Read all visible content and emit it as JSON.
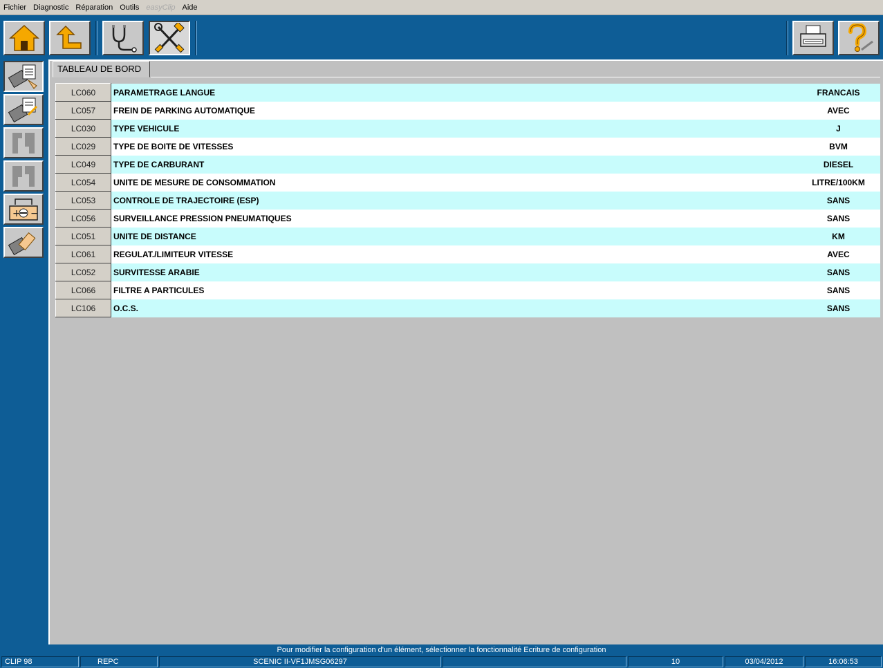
{
  "menu": {
    "items": [
      "Fichier",
      "Diagnostic",
      "Réparation",
      "Outils",
      "easyClip",
      "Aide"
    ]
  },
  "toolbar": {
    "buttons": [
      "home-icon",
      "back-arrow-icon",
      "stethoscope-icon",
      "tools-icon",
      "printer-icon",
      "help-icon"
    ]
  },
  "sidebar": {
    "buttons": [
      "ecu-config-read-icon",
      "ecu-config-write-icon",
      "parameters-icon",
      "parameters-alt-icon",
      "battery-icon",
      "ecu-erase-icon"
    ]
  },
  "main": {
    "tab_label": "TABLEAU DE BORD",
    "rows": [
      {
        "code": "LC060",
        "label": "PARAMETRAGE LANGUE",
        "value": "FRANCAIS"
      },
      {
        "code": "LC057",
        "label": "FREIN DE PARKING AUTOMATIQUE",
        "value": "AVEC"
      },
      {
        "code": "LC030",
        "label": "TYPE VEHICULE",
        "value": "J"
      },
      {
        "code": "LC029",
        "label": "TYPE DE BOITE DE VITESSES",
        "value": "BVM"
      },
      {
        "code": "LC049",
        "label": "TYPE DE CARBURANT",
        "value": "DIESEL"
      },
      {
        "code": "LC054",
        "label": "UNITE DE MESURE DE CONSOMMATION",
        "value": "LITRE/100KM"
      },
      {
        "code": "LC053",
        "label": "CONTROLE DE TRAJECTOIRE (ESP)",
        "value": "SANS"
      },
      {
        "code": "LC056",
        "label": "SURVEILLANCE PRESSION PNEUMATIQUES",
        "value": "SANS"
      },
      {
        "code": "LC051",
        "label": "UNITE DE DISTANCE",
        "value": "KM"
      },
      {
        "code": "LC061",
        "label": "REGULAT./LIMITEUR VITESSE",
        "value": "AVEC"
      },
      {
        "code": "LC052",
        "label": "SURVITESSE ARABIE",
        "value": "SANS"
      },
      {
        "code": "LC066",
        "label": "FILTRE A PARTICULES",
        "value": "SANS"
      },
      {
        "code": "LC106",
        "label": "O.C.S.",
        "value": "SANS"
      }
    ]
  },
  "status": {
    "message": "Pour modifier la configuration d'un élément, sélectionner la fonctionnalité Ecriture de configuration",
    "cells": [
      "CLIP 98",
      "REPC",
      "SCENIC II-VF1JMSG06297",
      "",
      "10",
      "03/04/2012",
      "16:06:53"
    ]
  },
  "colors": {
    "frame_blue": "#0e5d96",
    "row_cyan": "#c8fcfc",
    "row_white": "#ffffff",
    "panel_grey": "#c0c0c0"
  }
}
